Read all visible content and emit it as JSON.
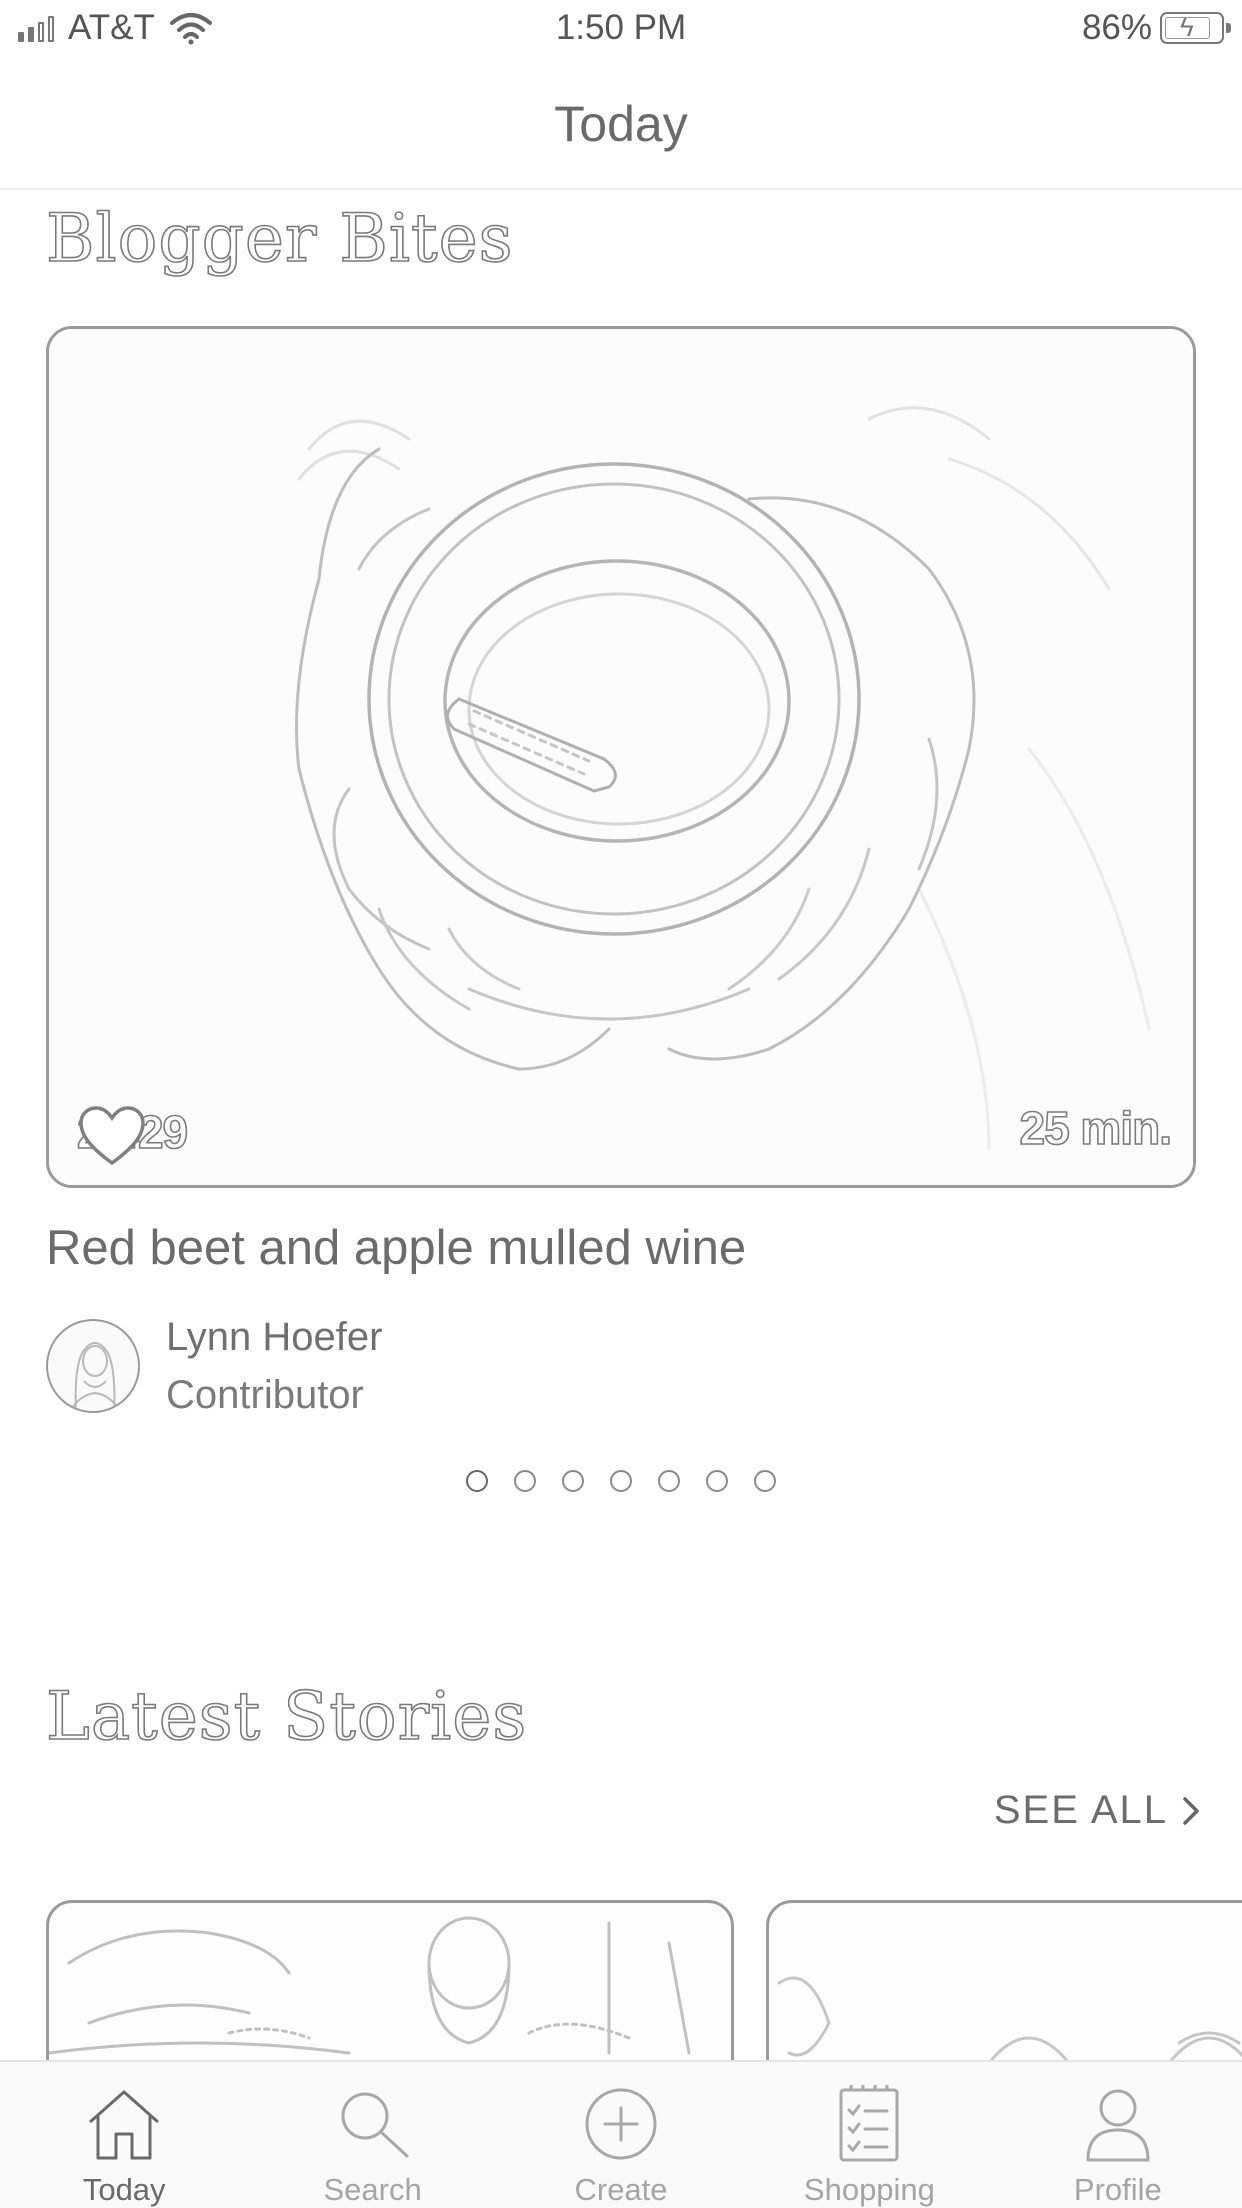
{
  "status_bar": {
    "carrier": "AT&T",
    "time": "1:50 PM",
    "battery_percent": "86%",
    "signal_bars": 2,
    "icons": [
      "signal-icon",
      "wifi-icon",
      "battery-icon"
    ]
  },
  "header": {
    "title": "Today"
  },
  "blogger_bites": {
    "section_title": "Blogger Bites",
    "card": {
      "likes": "2,429",
      "duration": "25 min.",
      "title": "Red beet and apple mulled wine",
      "author_name": "Lynn Hoefer",
      "author_role": "Contributor"
    },
    "pager": {
      "count": 7,
      "active_index": 0
    }
  },
  "latest_stories": {
    "section_title": "Latest Stories",
    "see_all_label": "SEE ALL"
  },
  "tab_bar": {
    "items": [
      {
        "label": "Today",
        "icon": "home-icon",
        "active": true
      },
      {
        "label": "Search",
        "icon": "search-icon",
        "active": false
      },
      {
        "label": "Create",
        "icon": "plus-circle-icon",
        "active": false
      },
      {
        "label": "Shopping",
        "icon": "shopping-list-icon",
        "active": false
      },
      {
        "label": "Profile",
        "icon": "profile-icon",
        "active": false
      }
    ]
  }
}
